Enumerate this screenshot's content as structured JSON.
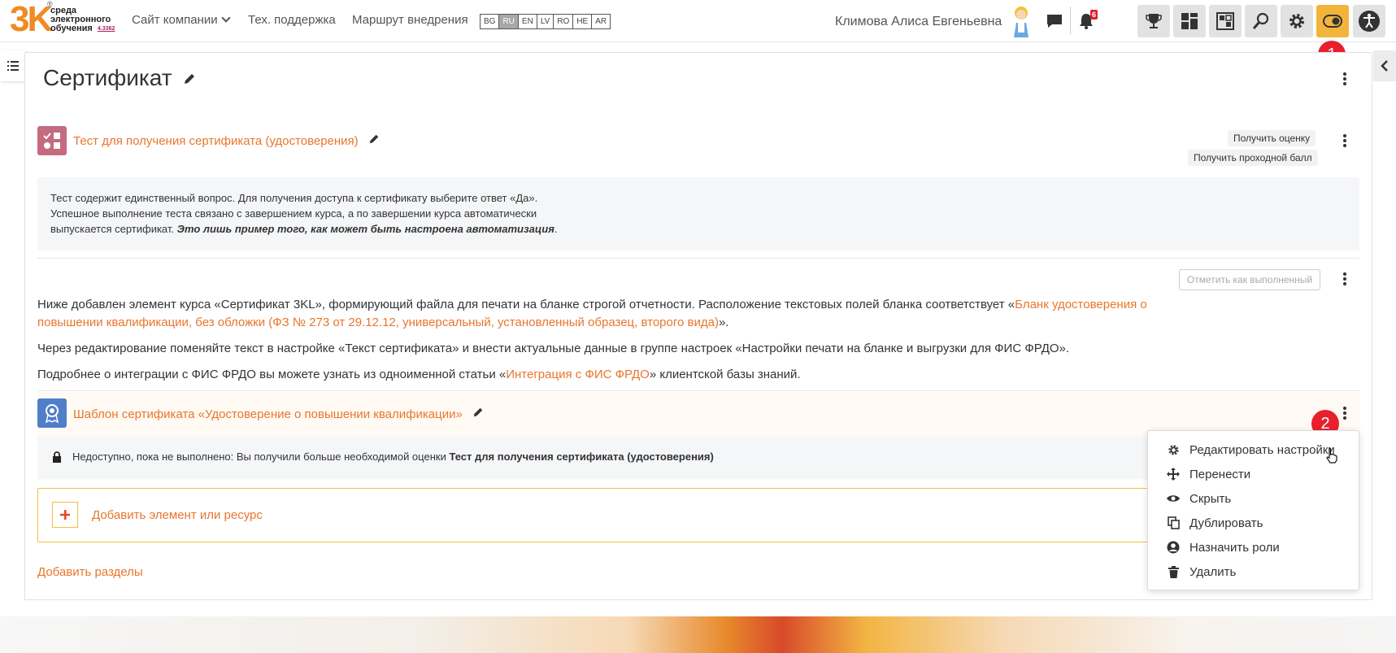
{
  "header": {
    "logo": {
      "number": "3K",
      "registered": "®",
      "text_lines": [
        "среда",
        "электронного",
        "обучения"
      ],
      "version": "4.3362"
    },
    "nav": {
      "company_site": "Сайт компании",
      "support": "Тех. поддержка",
      "rollout_route": "Маршрут внедрения"
    },
    "languages": [
      "BG",
      "RU",
      "EN",
      "LV",
      "RO",
      "HE",
      "AR"
    ],
    "active_language": "RU",
    "user_name": "Климова Алиса Евгеньевна",
    "notifications_count": "6",
    "step_badge_1": "1"
  },
  "page": {
    "title": "Сертификат"
  },
  "quiz": {
    "title": "Тест для получения сертификата (удостоверения)",
    "get_grade": "Получить оценку",
    "get_pass_grade": "Получить проходной балл",
    "desc_line1": "Тест содержит единственный вопрос. Для получения доступа к сертификату выберите ответ «Да».",
    "desc_line2": "Успешное выполнение теста связано с завершением курса, а по завершении курса автоматически",
    "desc_line3": "выпускается сертификат.",
    "desc_emphasis": "Это лишь пример того, как может быть настроена автоматизация",
    "desc_end": "."
  },
  "label_block": {
    "mark_done": "Отметить как выполненный",
    "p1_text": "Ниже добавлен элемент курса «Сертификат 3KL», формирующий файла для печати на бланке строгой отчетности. Расположение текстовых полей бланка соответствует  «",
    "p1_link_line1": "Бланк удостоверения о",
    "p1_link_line2": "повышении квалификации, без обложки (ФЗ № 273 от 29.12.12, универсальный, установленный образец, второго вида)",
    "p1_end": "».",
    "p2": "Через редактирование поменяйте текст в настройке «Текст сертификата» и внести актуальные данные в группе настроек «Настройки печати на бланке и выгрузки для ФИС ФРДО».",
    "p3_pre": "Подробнее о интеграции с ФИС ФРДО вы можете узнать из одноименной статьи «",
    "p3_link": "Интеграция с ФИС ФРДО",
    "p3_post": "» клиентской базы знаний."
  },
  "certificate": {
    "title": "Шаблон сертификата «Удостоверение о повышении квалификации»",
    "restriction_pre": "Недоступно, пока не выполнено: Вы получили больше необходимой оценки",
    "restriction_bold": "Тест для получения сертификата (удостоверения)",
    "step_badge_2": "2"
  },
  "add_activity": "Добавить элемент или ресурс",
  "add_sections": "Добавить разделы",
  "menu": {
    "items": [
      {
        "label": "Редактировать настройки",
        "icon": "gear-icon"
      },
      {
        "label": "Перенести",
        "icon": "move-icon"
      },
      {
        "label": "Скрыть",
        "icon": "eye-icon"
      },
      {
        "label": "Дублировать",
        "icon": "duplicate-icon"
      },
      {
        "label": "Назначить роли",
        "icon": "user-icon"
      },
      {
        "label": "Удалить",
        "icon": "trash-icon"
      }
    ]
  },
  "colors": {
    "accent": "#e8762d",
    "quiz_icon": "#c46b7f",
    "cert_icon": "#4f7fc8",
    "badge_red": "#e8202e",
    "toggle_yellow": "#f3b43c"
  }
}
